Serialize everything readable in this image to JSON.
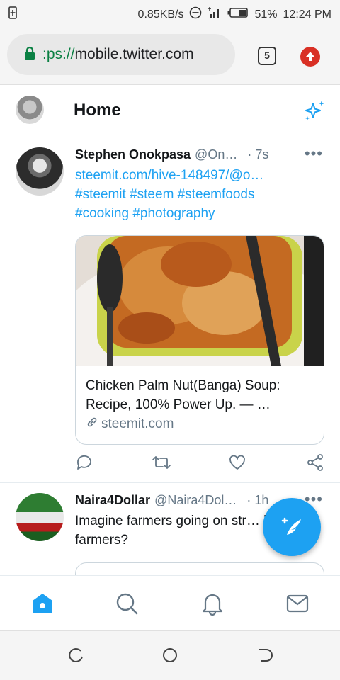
{
  "status_bar": {
    "speed": "0.85KB/s",
    "battery": "51%",
    "time": "12:24 PM"
  },
  "browser": {
    "url_scheme": ":ps://",
    "url_host": "mobile.twitter.com",
    "tab_count": "5"
  },
  "header": {
    "title": "Home"
  },
  "tweets": [
    {
      "name": "Stephen Onokpasa",
      "handle": "@On…",
      "time": "· 7s",
      "link": "steemit.com/hive-148497/@o…",
      "hashtags_line1": "#steemit #steem #steemfoods",
      "hashtags_line2": "#cooking #photography",
      "card": {
        "title": "Chicken Palm Nut(Banga) Soup: Recipe, 100% Power Up. — …",
        "domain": "steemit.com"
      }
    },
    {
      "name": "Naira4Dollar",
      "handle": "@Naira4Dol…",
      "time": "· 1h",
      "text": "Imagine farmers going on str… killing of farmers?"
    }
  ],
  "colors": {
    "accent": "#1da1f2",
    "secure_green": "#0a8043",
    "update_red": "#d93025"
  },
  "icons": {
    "nav": [
      "home-icon",
      "search-icon",
      "notifications-icon",
      "messages-icon"
    ]
  }
}
